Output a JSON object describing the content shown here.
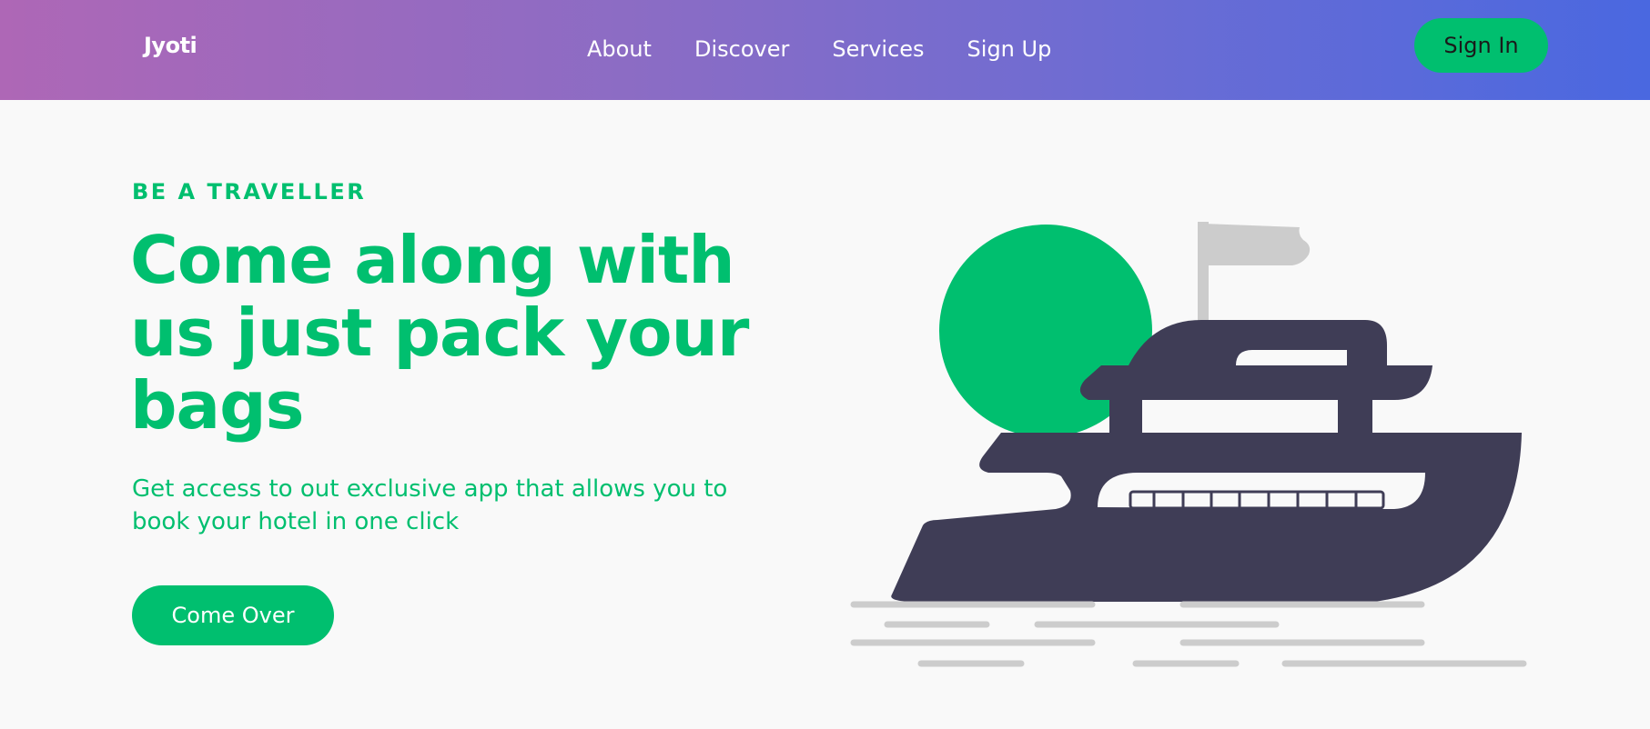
{
  "navbar": {
    "logo": "Jyoti",
    "links": [
      "About",
      "Discover",
      "Services",
      "Sign Up"
    ],
    "signin_label": "Sign In"
  },
  "hero": {
    "eyebrow": "BE A TRAVELLER",
    "title": "Come along with us just pack your bags",
    "subtitle": "Get access to out exclusive app that allows you to book your hotel in one click",
    "cta_label": "Come Over"
  },
  "colors": {
    "accent": "#00bf6f",
    "gradient_start": "#ae67b6",
    "gradient_end": "#4a68e0",
    "boat": "#3f3d56",
    "muted": "#cccccc",
    "background": "#f9f9f9"
  },
  "illustration": {
    "name": "ship-illustration"
  }
}
